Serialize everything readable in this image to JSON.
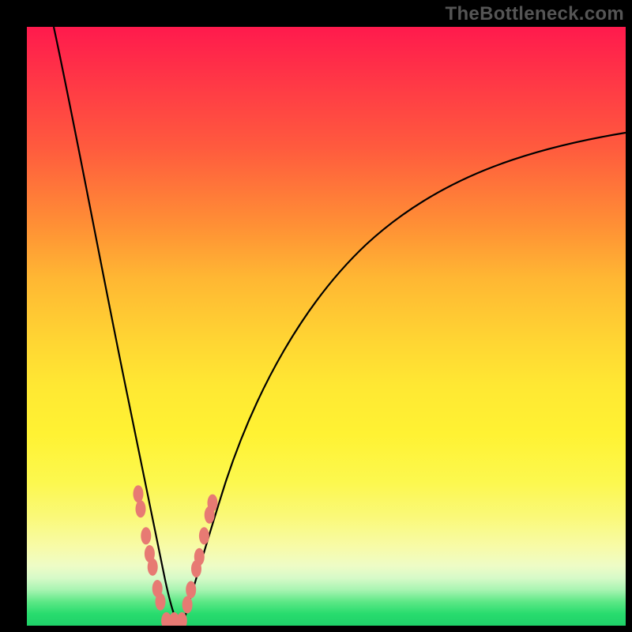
{
  "watermark": "TheBottleneck.com",
  "colors": {
    "background": "#000000",
    "curve": "#000000",
    "marker": "#e77a73",
    "gradient_top": "#ff1a4d",
    "gradient_bottom": "#1fd168"
  },
  "chart_data": {
    "type": "line",
    "title": "",
    "xlabel": "",
    "ylabel": "",
    "xlim": [
      0,
      100
    ],
    "ylim": [
      0,
      100
    ],
    "note": "Axes are unlabeled in the source image; values below are estimated from pixel positions on a 0–100 normalized scale.",
    "series": [
      {
        "name": "left-branch",
        "x": [
          4.5,
          6,
          8,
          10,
          12,
          14,
          16,
          18,
          19.5,
          21,
          22.5,
          24
        ],
        "y": [
          100,
          91,
          79,
          68,
          57,
          47,
          36,
          26,
          18,
          11,
          5,
          0
        ]
      },
      {
        "name": "right-branch",
        "x": [
          26,
          28,
          30,
          33,
          37,
          42,
          48,
          55,
          63,
          72,
          82,
          92,
          100
        ],
        "y": [
          0,
          7,
          15,
          25,
          36,
          46,
          55,
          62,
          68,
          73,
          77,
          80,
          82
        ]
      }
    ],
    "markers": [
      {
        "x": 18.6,
        "y": 22.0
      },
      {
        "x": 19.0,
        "y": 19.5
      },
      {
        "x": 19.9,
        "y": 15.0
      },
      {
        "x": 20.5,
        "y": 12.0
      },
      {
        "x": 21.0,
        "y": 9.8
      },
      {
        "x": 21.8,
        "y": 6.2
      },
      {
        "x": 22.3,
        "y": 4.0
      },
      {
        "x": 23.3,
        "y": 0.8
      },
      {
        "x": 24.6,
        "y": 0.8
      },
      {
        "x": 25.9,
        "y": 0.8
      },
      {
        "x": 26.8,
        "y": 3.5
      },
      {
        "x": 27.4,
        "y": 6.0
      },
      {
        "x": 28.3,
        "y": 9.5
      },
      {
        "x": 28.8,
        "y": 11.5
      },
      {
        "x": 29.6,
        "y": 15.0
      },
      {
        "x": 30.5,
        "y": 18.5
      },
      {
        "x": 31.0,
        "y": 20.5
      }
    ]
  }
}
